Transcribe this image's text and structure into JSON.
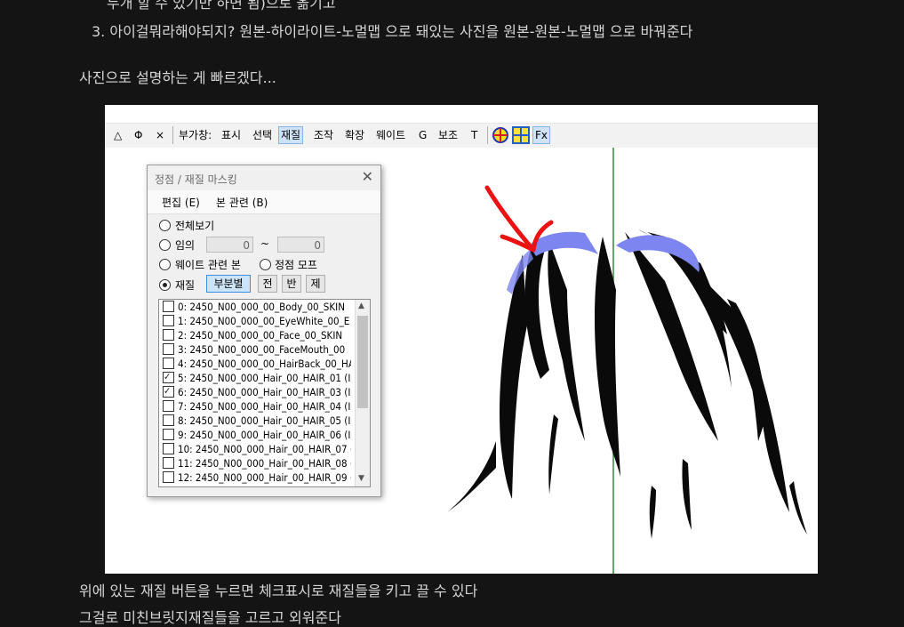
{
  "blog": {
    "line_top": "두개 할 수 있기만 하면 됨)으로 옮기고",
    "line_3": "3. 아이걸뭐라해야되지? 원본-하이라이트-노멀맵 으로 돼있는 사진을 원본-원본-노멀맵 으로 바꿔준다",
    "line_photo": "사진으로 설명하는 게 빠르겠다...",
    "line_bottom1": "위에 있는 재질 버튼을 누르면 체크표시로 재질들을 키고 끌 수 있다",
    "line_bottom2": "그걸로 미친브릿지재질들을 고르고 외워준다"
  },
  "toolbar": {
    "btn_triangle": "△",
    "btn_phi": "Φ",
    "btn_x": "×",
    "label": "부가창:",
    "items": [
      "표시",
      "선택",
      "재질",
      "조작",
      "확장",
      "웨이트",
      "G",
      "보조",
      "T"
    ],
    "active_item": "재질",
    "fx": "Fx"
  },
  "dialog": {
    "title": "정점 / 재질 마스킹",
    "close": "✕",
    "menu": [
      "편집 (E)",
      "본 관련 (B)"
    ],
    "options": {
      "all": "전체보기",
      "arbitrary": "임의",
      "from_value": "0",
      "tilde": "~",
      "to_value": "0",
      "weight_bone": "웨이트 관련 본",
      "vertex_morph": "정점 모프",
      "material": "재질",
      "partial": "부분별",
      "btn_all": "전",
      "btn_invert": "반",
      "btn_remove": "제"
    },
    "materials": [
      {
        "label": "0: 2450_N00_000_00_Body_00_SKIN",
        "checked": false
      },
      {
        "label": "1: 2450_N00_000_00_EyeWhite_00_E",
        "checked": false
      },
      {
        "label": "2: 2450_N00_000_00_Face_00_SKIN",
        "checked": false
      },
      {
        "label": "3: 2450_N00_000_00_FaceMouth_00",
        "checked": false
      },
      {
        "label": "4: 2450_N00_000_00_HairBack_00_HA",
        "checked": false
      },
      {
        "label": "5: 2450_N00_000_Hair_00_HAIR_01 (I",
        "checked": true
      },
      {
        "label": "6: 2450_N00_000_Hair_00_HAIR_03 (I",
        "checked": true
      },
      {
        "label": "7: 2450_N00_000_Hair_00_HAIR_04 (I",
        "checked": false
      },
      {
        "label": "8: 2450_N00_000_Hair_00_HAIR_05 (I",
        "checked": false
      },
      {
        "label": "9: 2450_N00_000_Hair_00_HAIR_06 (I",
        "checked": false
      },
      {
        "label": "10: 2450_N00_000_Hair_00_HAIR_07 (",
        "checked": false
      },
      {
        "label": "11: 2450_N00_000_Hair_00_HAIR_08 (",
        "checked": false
      },
      {
        "label": "12: 2450_N00_000_Hair_00_HAIR_09 (",
        "checked": false
      }
    ]
  },
  "colors": {
    "page_bg": "#141414",
    "highlight_blue": "#7d86f0",
    "arrow_red": "#ee1111",
    "axis_green": "#2e8b3a"
  }
}
